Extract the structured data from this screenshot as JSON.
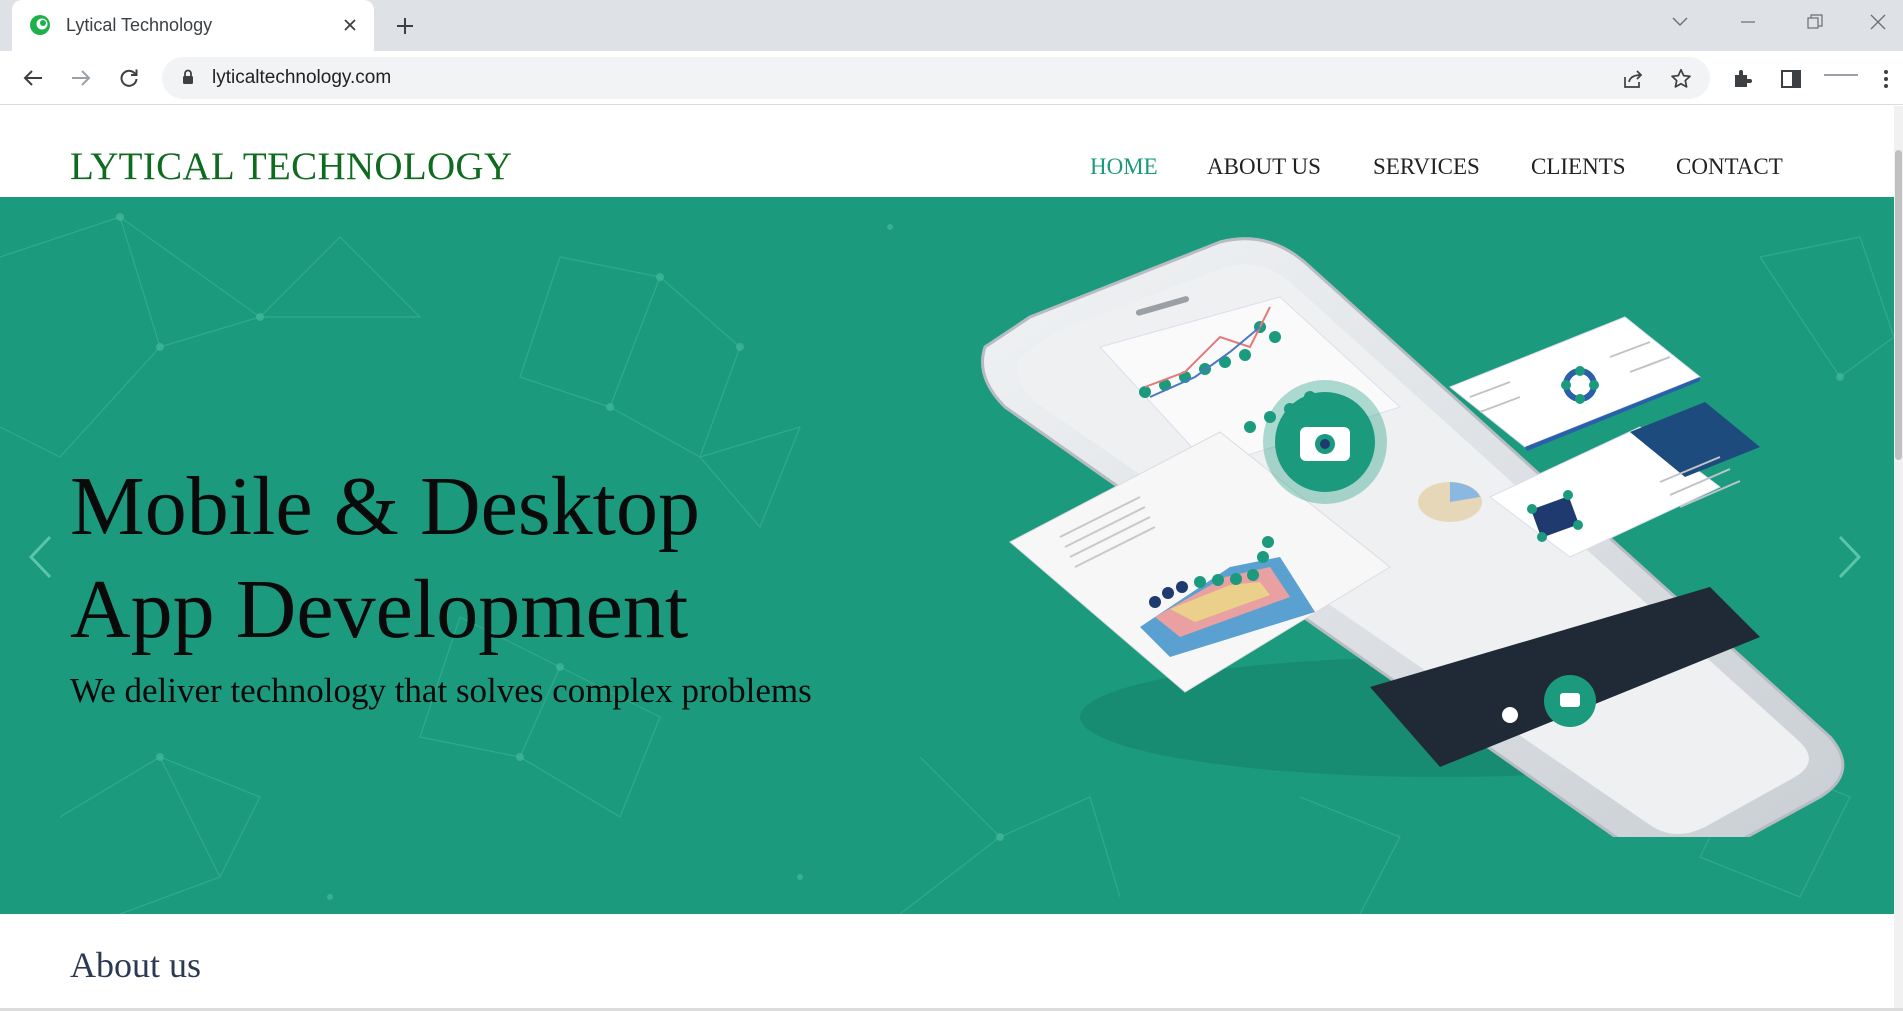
{
  "browser": {
    "tab_title": "Lytical Technology",
    "url": "lyticaltechnology.com"
  },
  "site": {
    "logo": "LYTICAL TECHNOLOGY",
    "nav": [
      "HOME",
      "ABOUT US",
      "SERVICES",
      "CLIENTS",
      "CONTACT"
    ],
    "active_nav": "HOME",
    "hero": {
      "title_line1": "Mobile & Desktop",
      "title_line2": "App Development",
      "subtitle": "We deliver technology that solves complex problems"
    },
    "about_heading": "About us"
  },
  "colors": {
    "hero_bg": "#1b9a7e",
    "logo": "#0e6b1f",
    "nav_active": "#1a9a7c",
    "about_heading": "#2b3a52"
  },
  "icons": [
    "tab-favicon-icon",
    "close-icon",
    "plus-icon",
    "chevron-down-icon",
    "minimize-icon",
    "restore-icon",
    "window-close-icon",
    "back-arrow-icon",
    "forward-arrow-icon",
    "reload-icon",
    "lock-icon",
    "share-icon",
    "star-icon",
    "extensions-icon",
    "side-panel-icon",
    "more-icon",
    "chevron-left-icon",
    "chevron-right-icon"
  ]
}
